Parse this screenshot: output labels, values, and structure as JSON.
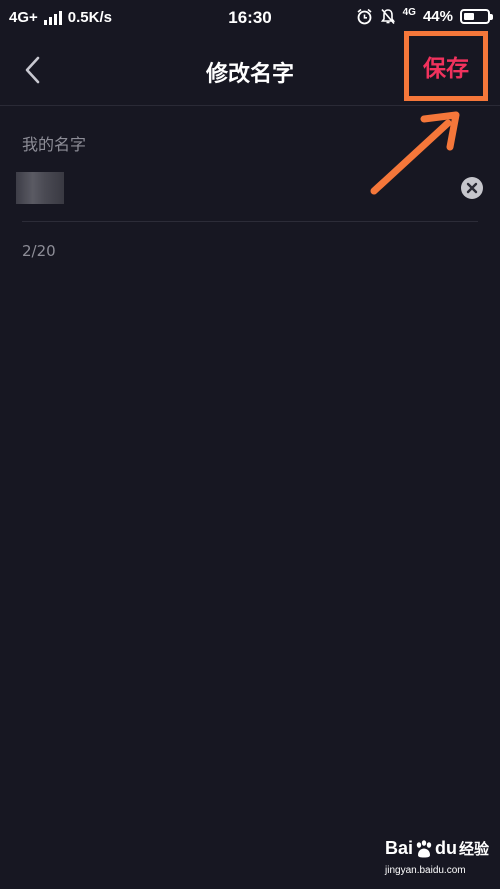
{
  "status_bar": {
    "network": "4G+",
    "speed": "0.5K/s",
    "time": "16:30",
    "mobile_tag": "4G",
    "battery_percent": "44%",
    "battery_level": 0.44
  },
  "nav": {
    "title": "修改名字",
    "save_label": "保存",
    "accent_color": "#f1325d",
    "highlight_color": "#f5773a"
  },
  "form": {
    "label": "我的名字",
    "name_value": "",
    "char_count": "2/20"
  },
  "watermark": {
    "logo_text_1": "Bai",
    "logo_text_2": "du",
    "logo_suffix": "经验",
    "url": "jingyan.baidu.com"
  },
  "icons": [
    "back-arrow-icon",
    "alarm-clock-icon",
    "bell-muted-icon",
    "battery-icon",
    "signal-icon",
    "clear-icon",
    "annotation-arrow-icon",
    "baidu-paw-icon"
  ]
}
